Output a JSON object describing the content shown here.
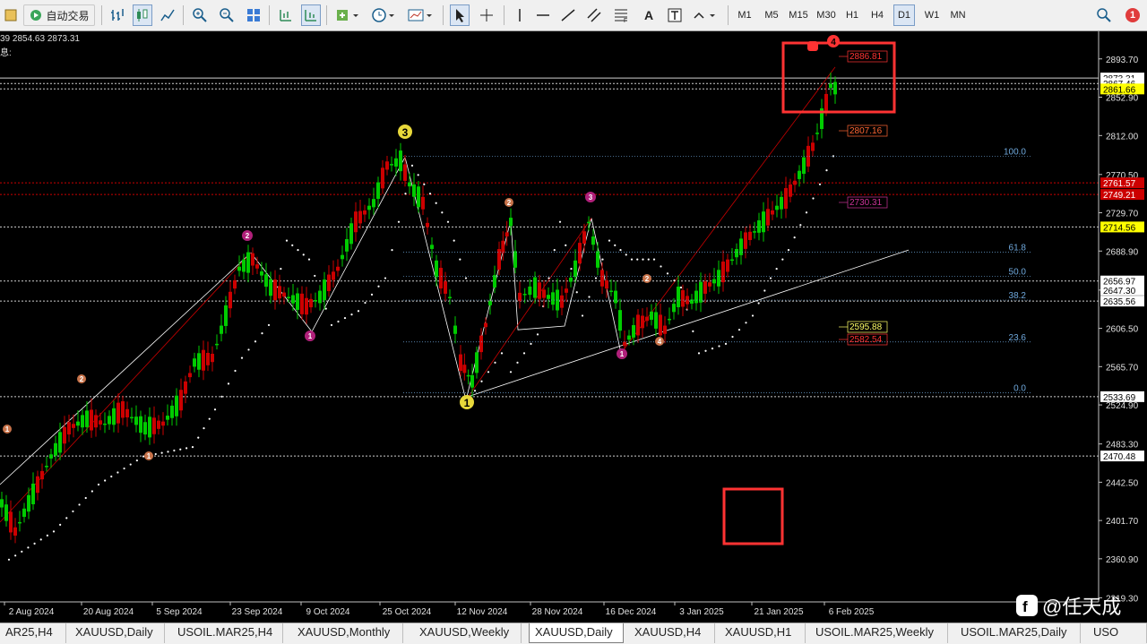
{
  "toolbar": {
    "auto_trading_label": "自动交易",
    "timeframes": [
      "M1",
      "M5",
      "M15",
      "M30",
      "H1",
      "H4",
      "D1",
      "W1",
      "MN"
    ],
    "active_timeframe": "D1",
    "text_tool_label": "A",
    "notification_count": "1"
  },
  "chart_info": {
    "ohlc_partial": "39 2854.63 2873.31",
    "subline": "息:"
  },
  "chart_data": {
    "type": "candlestick",
    "symbol": "XAUUSD",
    "timeframe": "D1",
    "price_axis": [
      "2893.70",
      "2852.90",
      "2812.00",
      "2770.50",
      "2729.70",
      "2688.90",
      "2647.30",
      "2606.50",
      "2565.70",
      "2524.90",
      "2483.30",
      "2442.50",
      "2401.70",
      "2360.90",
      "2319.30"
    ],
    "date_axis": [
      "2 Aug 2024",
      "20 Aug 2024",
      "5 Sep 2024",
      "23 Sep 2024",
      "9 Oct 2024",
      "25 Oct 2024",
      "12 Nov 2024",
      "28 Nov 2024",
      "16 Dec 2024",
      "3 Jan 2025",
      "21 Jan 2025",
      "6 Feb 2025"
    ],
    "price_tags": [
      {
        "text": "2873.31",
        "bg": "#ffffff",
        "fg": "#000000"
      },
      {
        "text": "2867.46",
        "bg": "#ffffff",
        "fg": "#000000"
      },
      {
        "text": "2861.66",
        "bg": "#ffff00",
        "fg": "#000000"
      },
      {
        "text": "2761.57",
        "bg": "#cc0000",
        "fg": "#ffffff"
      },
      {
        "text": "2749.21",
        "bg": "#cc0000",
        "fg": "#ffffff"
      },
      {
        "text": "2714.56",
        "bg": "#ffff00",
        "fg": "#000000"
      },
      {
        "text": "2656.97",
        "bg": "#ffffff",
        "fg": "#000000"
      },
      {
        "text": "2647.30",
        "bg": "#ffffff",
        "fg": "#000000"
      },
      {
        "text": "2635.56",
        "bg": "#ffffff",
        "fg": "#000000"
      },
      {
        "text": "2533.69",
        "bg": "#ffffff",
        "fg": "#000000"
      },
      {
        "text": "2470.48",
        "bg": "#ffffff",
        "fg": "#000000"
      }
    ],
    "chart_labels": [
      {
        "text": "2886.81",
        "color": "#ff3333"
      },
      {
        "text": "2807.16",
        "color": "#ff6633"
      },
      {
        "text": "2730.31",
        "color": "#cc3399"
      },
      {
        "text": "2595.88",
        "color": "#ffff66"
      },
      {
        "text": "2582.54",
        "color": "#ff3333"
      }
    ],
    "fibonacci_levels": [
      "100.0",
      "61.8",
      "50.0",
      "38.2",
      "23.6",
      "0.0"
    ],
    "wave_labels": [
      "1",
      "2",
      "1",
      "2",
      "3",
      "1",
      "2",
      "3",
      "1",
      "2",
      "1",
      "4"
    ],
    "colors": {
      "bull": "#00cc00",
      "bear": "#cc0000",
      "highlight_box": "#ff3333",
      "fib": "#6fa8dc"
    }
  },
  "tabs": [
    "AR25,H4",
    "XAUUSD,Daily",
    "USOIL.MAR25,H4",
    "XAUUSD,Monthly",
    "XAUUSD,Weekly",
    "XAUUSD,Daily",
    "XAUUSD,H4",
    "XAUUSD,H1",
    "USOIL.MAR25,Weekly",
    "USOIL.MAR25,Daily",
    "USO"
  ],
  "active_tab_index": 5,
  "watermark": {
    "text": "@任天成"
  }
}
